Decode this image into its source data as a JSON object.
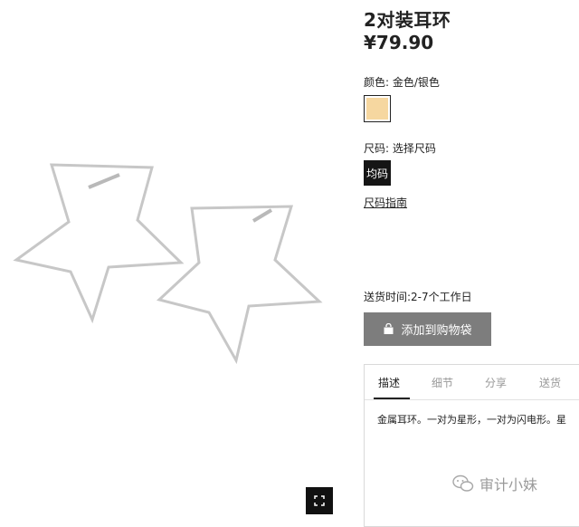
{
  "product": {
    "title": "2对装耳环",
    "price": "¥79.90",
    "color_label": "颜色: 金色/银色",
    "swatch_color": "#f6d7a0",
    "size_label": "尺码: 选择尺码",
    "size_option": "均码",
    "size_guide": "尺码指南",
    "delivery": "送货时间:2-7个工作日",
    "add_to_bag": "添加到购物袋"
  },
  "tabs": [
    "描述",
    "细节",
    "分享",
    "送货"
  ],
  "description": "金属耳环。一对为星形，一对为闪电形。星",
  "watermark": "审计小妹",
  "icons": {
    "fullscreen": "fullscreen-icon",
    "bag": "shopping-bag-icon",
    "watermark": "wechat-icon"
  }
}
